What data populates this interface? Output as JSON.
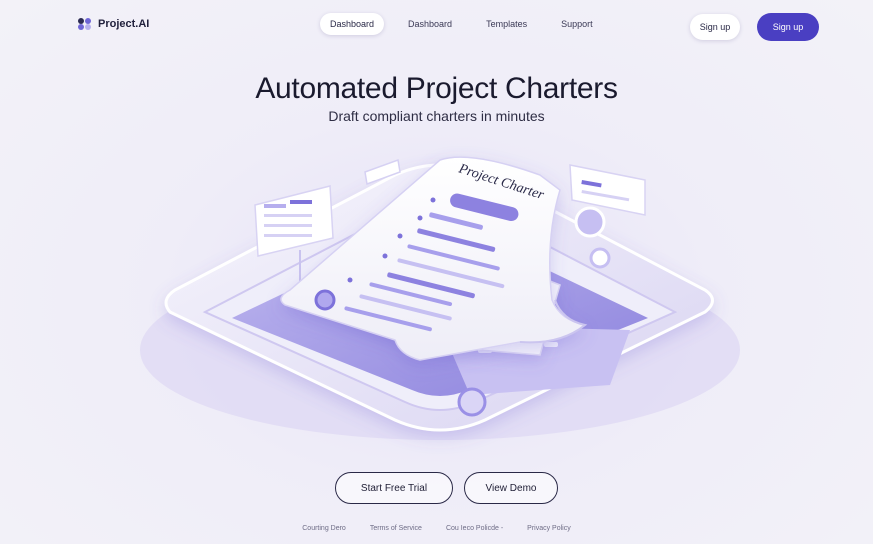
{
  "brand": {
    "name": "Project.AI",
    "logo_icon": "four-dot-logo-icon"
  },
  "nav": {
    "links": [
      {
        "label": "Dashboard",
        "active": true
      },
      {
        "label": "Dashboard",
        "active": false
      },
      {
        "label": "Templates",
        "active": false
      },
      {
        "label": "Support",
        "active": false
      }
    ],
    "signin_label": "Sign up",
    "signup_label": "Sign up"
  },
  "hero": {
    "title": "Automated Project Charters",
    "subtitle": "Draft compliant charters in minutes",
    "document_title": "Project Charter"
  },
  "cta": {
    "trial_label": "Start Free Trial",
    "demo_label": "View Demo"
  },
  "footer": {
    "links": [
      "Courting Dero",
      "Terms of Service",
      "Cou  Ieco Policde -",
      "Privacy Policy"
    ]
  },
  "colors": {
    "accent": "#4a3fc2",
    "lavender": "#9a90e6",
    "background": "#f1f0f7"
  }
}
